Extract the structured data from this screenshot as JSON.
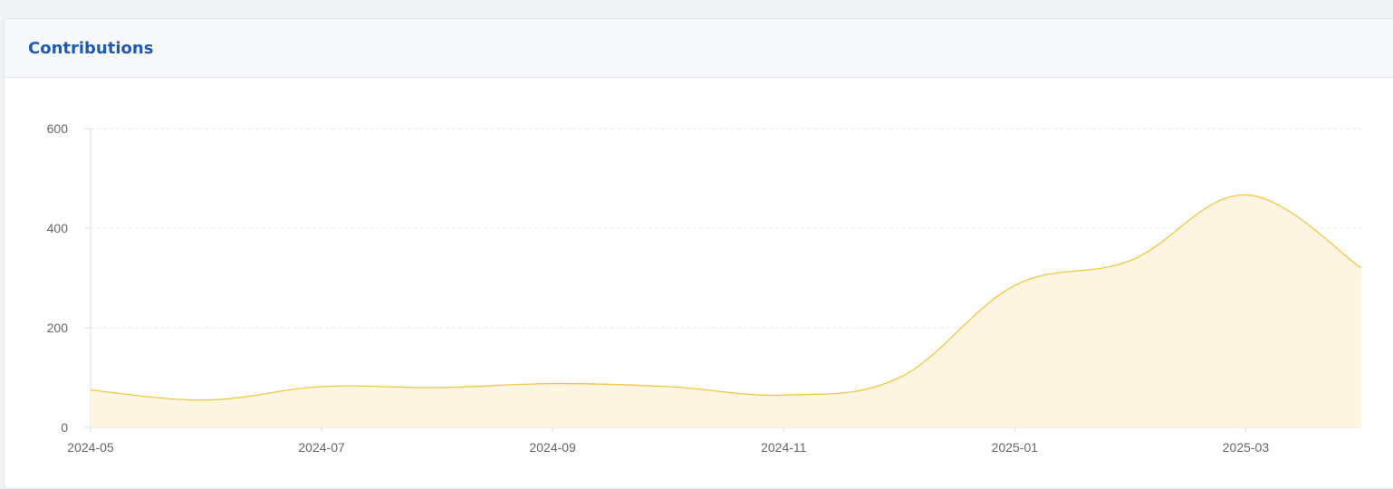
{
  "card": {
    "title": "Contributions"
  },
  "colors": {
    "title": "#1e5bb0",
    "line": "#f2c744",
    "area": "#fdf5e2",
    "grid": "#e8e8e8",
    "axis": "#dddddd"
  },
  "chart_data": {
    "type": "area",
    "title": "",
    "xlabel": "",
    "ylabel": "",
    "x": [
      "2024-05",
      "2024-06",
      "2024-07",
      "2024-08",
      "2024-09",
      "2024-10",
      "2024-11",
      "2024-12",
      "2025-01",
      "2025-02",
      "2025-03",
      "2025-04"
    ],
    "values": [
      75,
      55,
      82,
      80,
      88,
      82,
      65,
      100,
      285,
      335,
      467,
      320
    ],
    "ylim": [
      0,
      600
    ],
    "yticks": [
      "0",
      "200",
      "400",
      "600"
    ],
    "xticks": [
      "2024-05",
      "2024-07",
      "2024-09",
      "2024-11",
      "2025-01",
      "2025-03"
    ],
    "grid": true,
    "smooth": true
  }
}
